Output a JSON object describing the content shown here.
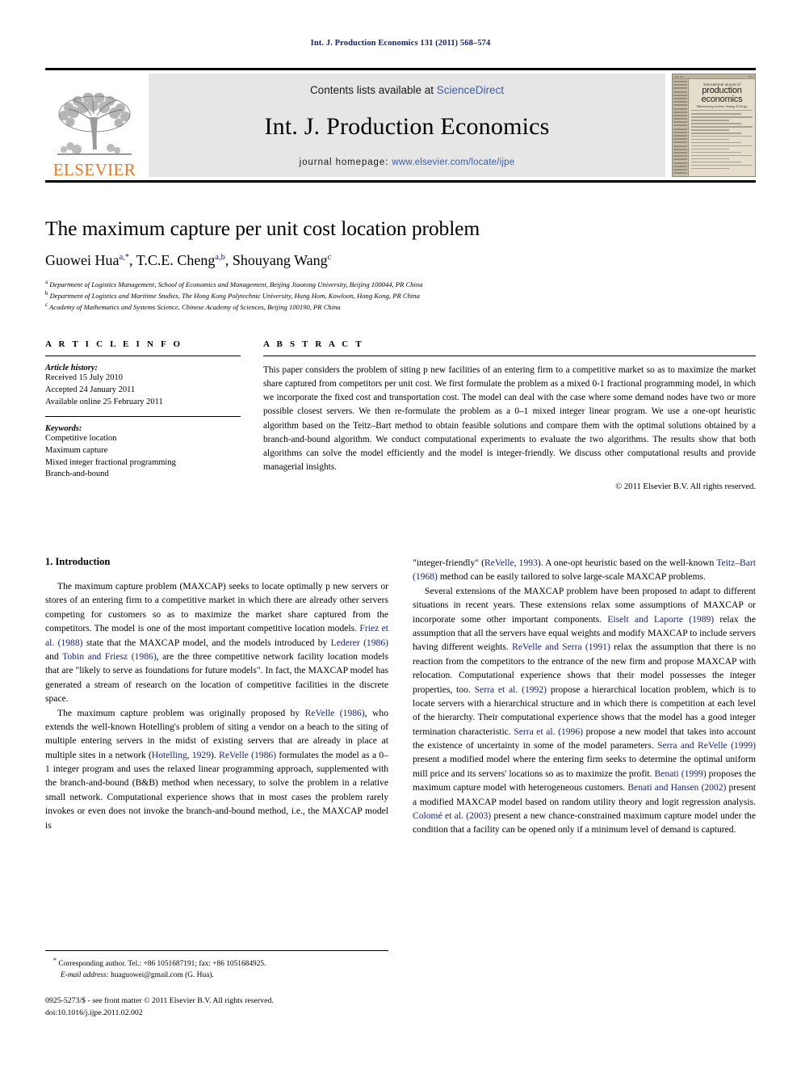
{
  "running_head": "Int. J. Production Economics 131 (2011) 568–574",
  "masthead": {
    "publisher_name": "ELSEVIER",
    "contents_prefix": "Contents lists available at ",
    "contents_link": "ScienceDirect",
    "journal_title": "Int. J. Production Economics",
    "homepage_prefix": "journal homepage: ",
    "homepage_url": "www.elsevier.com/locate/ijpe",
    "cover": {
      "kicker": "international journal of",
      "line1": "production",
      "line2": "economics",
      "subtitle": "Manufacturing Systems, Strategy & Design"
    }
  },
  "title": "The maximum capture per unit cost location problem",
  "authors": [
    {
      "name": "Guowei Hua",
      "marks": "a,*"
    },
    {
      "name": "T.C.E. Cheng",
      "marks": "a,b"
    },
    {
      "name": "Shouyang Wang",
      "marks": "c"
    }
  ],
  "affiliations": [
    {
      "mark": "a",
      "text": "Department of Logistics Management, School of Economics and Management, Beijing Jiaotong University, Beijing 100044, PR China"
    },
    {
      "mark": "b",
      "text": "Department of Logistics and Maritime Studies, The Hong Kong Polytechnic University, Hung Hom, Kowloon, Hong Kong, PR China"
    },
    {
      "mark": "c",
      "text": "Academy of Mathematics and Systems Science, Chinese Academy of Sciences, Beijing 100190, PR China"
    }
  ],
  "article_info": {
    "heading": "A R T I C L E   I N F O",
    "history_label": "Article history:",
    "history": [
      "Received 15 July 2010",
      "Accepted 24 January 2011",
      "Available online 25 February 2011"
    ],
    "keywords_label": "Keywords:",
    "keywords": [
      "Competitive location",
      "Maximum capture",
      "Mixed integer fractional programming",
      "Branch-and-bound"
    ]
  },
  "abstract": {
    "heading": "A B S T R A C T",
    "text": "This paper considers the problem of siting p new facilities of an entering firm to a competitive market so as to maximize the market share captured from competitors per unit cost. We first formulate the problem as a mixed 0-1 fractional programming model, in which we incorporate the fixed cost and transportation cost. The model can deal with the case where some demand nodes have two or more possible closest servers. We then re-formulate the problem as a 0–1 mixed integer linear program. We use a one-opt heuristic algorithm based on the Teitz–Bart method to obtain feasible solutions and compare them with the optimal solutions obtained by a branch-and-bound algorithm. We conduct computational experiments to evaluate the two algorithms. The results show that both algorithms can solve the model efficiently and the model is integer-friendly. We discuss other computational results and provide managerial insights.",
    "copyright": "© 2011 Elsevier B.V. All rights reserved."
  },
  "body": {
    "section_number_title": "1. Introduction",
    "left_paragraphs": [
      "The maximum capture problem (MAXCAP) seeks to locate optimally p new servers or stores of an entering firm to a competitive market in which there are already other servers competing for customers so as to maximize the market share captured from the competitors. The model is one of the most important competitive location models. Friez et al. (1988) state that the MAXCAP model, and the models introduced by Lederer (1986) and Tobin and Friesz (1986), are the three competitive network facility location models that are \"likely to serve as foundations for future models\". In fact, the MAXCAP model has generated a stream of research on the location of competitive facilities in the discrete space.",
      "The maximum capture problem was originally proposed by ReVelle (1986), who extends the well-known Hotelling's problem of siting a vendor on a beach to the siting of multiple entering servers in the midst of existing servers that are already in place at multiple sites in a network (Hotelling, 1929). ReVelle (1986) formulates the model as a 0–1 integer program and uses the relaxed linear programming approach, supplemented with the branch-and-bound (B&B) method when necessary, to solve the problem in a relative small network. Computational experience shows that in most cases the problem rarely invokes or even does not invoke the branch-and-bound method, i.e., the MAXCAP model is"
    ],
    "right_paragraphs": [
      "\"integer-friendly\" (ReVelle, 1993). A one-opt heuristic based on the well-known Teitz–Bart (1968) method can be easily tailored to solve large-scale MAXCAP problems.",
      "Several extensions of the MAXCAP problem have been proposed to adapt to different situations in recent years. These extensions relax some assumptions of MAXCAP or incorporate some other important components. Eiselt and Laporte (1989) relax the assumption that all the servers have equal weights and modify MAXCAP to include servers having different weights. ReVelle and Serra (1991) relax the assumption that there is no reaction from the competitors to the entrance of the new firm and propose MAXCAP with relocation. Computational experience shows that their model possesses the integer properties, too. Serra et al. (1992) propose a hierarchical location problem, which is to locate servers with a hierarchical structure and in which there is competition at each level of the hierarchy. Their computational experience shows that the model has a good integer termination characteristic. Serra et al. (1996) propose a new model that takes into account the existence of uncertainty in some of the model parameters. Serra and ReVelle (1999) present a modified model where the entering firm seeks to determine the optimal uniform mill price and its servers' locations so as to maximize the profit. Benati (1999) proposes the maximum capture model with heterogeneous customers. Benati and Hansen (2002) present a modified MAXCAP model based on random utility theory and logit regression analysis. Colomé et al. (2003) present a new chance-constrained maximum capture model under the condition that a facility can be opened only if a minimum level of demand is captured."
    ]
  },
  "footnotes": {
    "corresponding": "Corresponding author. Tel.: +86 1051687191; fax: +86 1051684925.",
    "email_label": "E-mail address:",
    "email_value": "huaguowei@gmail.com (G. Hua)."
  },
  "footer": {
    "issn_line": "0925-5273/$ - see front matter © 2011 Elsevier B.V. All rights reserved.",
    "doi_line": "doi:10.1016/j.ijpe.2011.02.002"
  },
  "colors": {
    "link_blue": "#3a5fa8",
    "citation_blue": "#13237a",
    "elsevier_orange": "#e87722",
    "banner_gray": "#e6e6e6"
  }
}
